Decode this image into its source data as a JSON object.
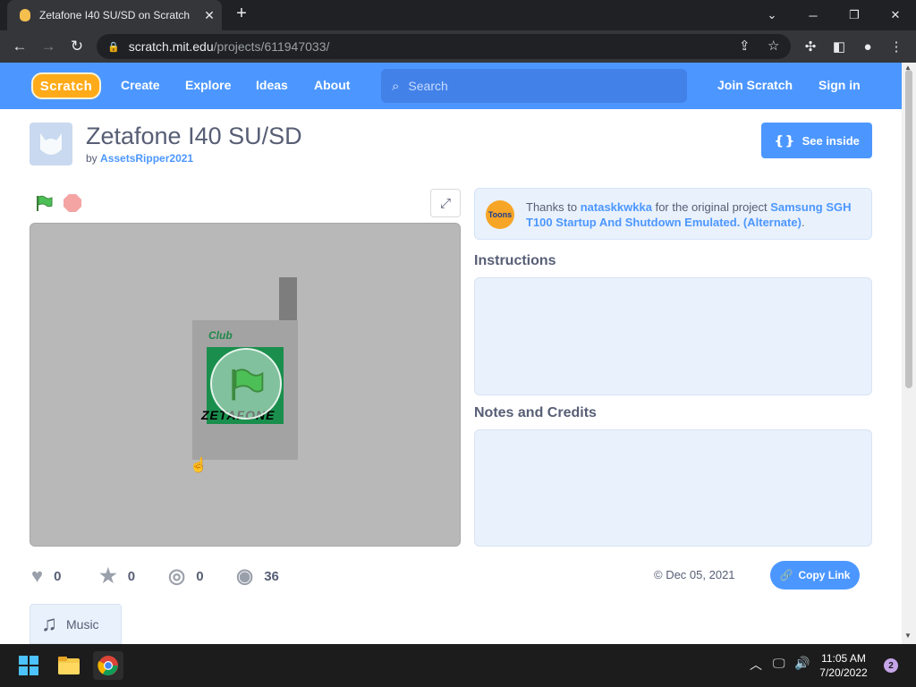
{
  "browser": {
    "tab_title": "Zetafone I40 SU/SD on Scratch",
    "tab_close_icon": "close-icon",
    "new_tab_icon": "plus-icon",
    "url_host": "scratch.mit.edu",
    "url_path": "/projects/611947033/"
  },
  "nav": {
    "logo": "Scratch",
    "links": [
      "Create",
      "Explore",
      "Ideas",
      "About"
    ],
    "search_placeholder": "Search",
    "join": "Join Scratch",
    "signin": "Sign in"
  },
  "project": {
    "title": "Zetafone I40 SU/SD",
    "by": "by",
    "author": "AssetsRipper2021",
    "see_inside": "See inside",
    "stage": {
      "club": "Club",
      "brand": "ZETAFONE"
    }
  },
  "credit": {
    "prefix": "Thanks to",
    "user": "nataskkwkka",
    "middle": "for the original project",
    "project": "Samsung SGH T100 Startup And Shutdown Emulated. (Alternate)",
    "suffix": ".",
    "badge": "Toons"
  },
  "sections": {
    "instructions": "Instructions",
    "notes": "Notes and Credits"
  },
  "stats": {
    "loves": "0",
    "favorites": "0",
    "remixes": "0",
    "views": "36",
    "date": "© Dec 05, 2021",
    "copy_link": "Copy Link"
  },
  "tag": {
    "label": "Music"
  },
  "taskbar": {
    "time": "11:05 AM",
    "date": "7/20/2022",
    "notifications": "2"
  },
  "colors": {
    "accent": "#4c97ff",
    "logo": "#ffab19",
    "stage": "#b8b8b8"
  }
}
